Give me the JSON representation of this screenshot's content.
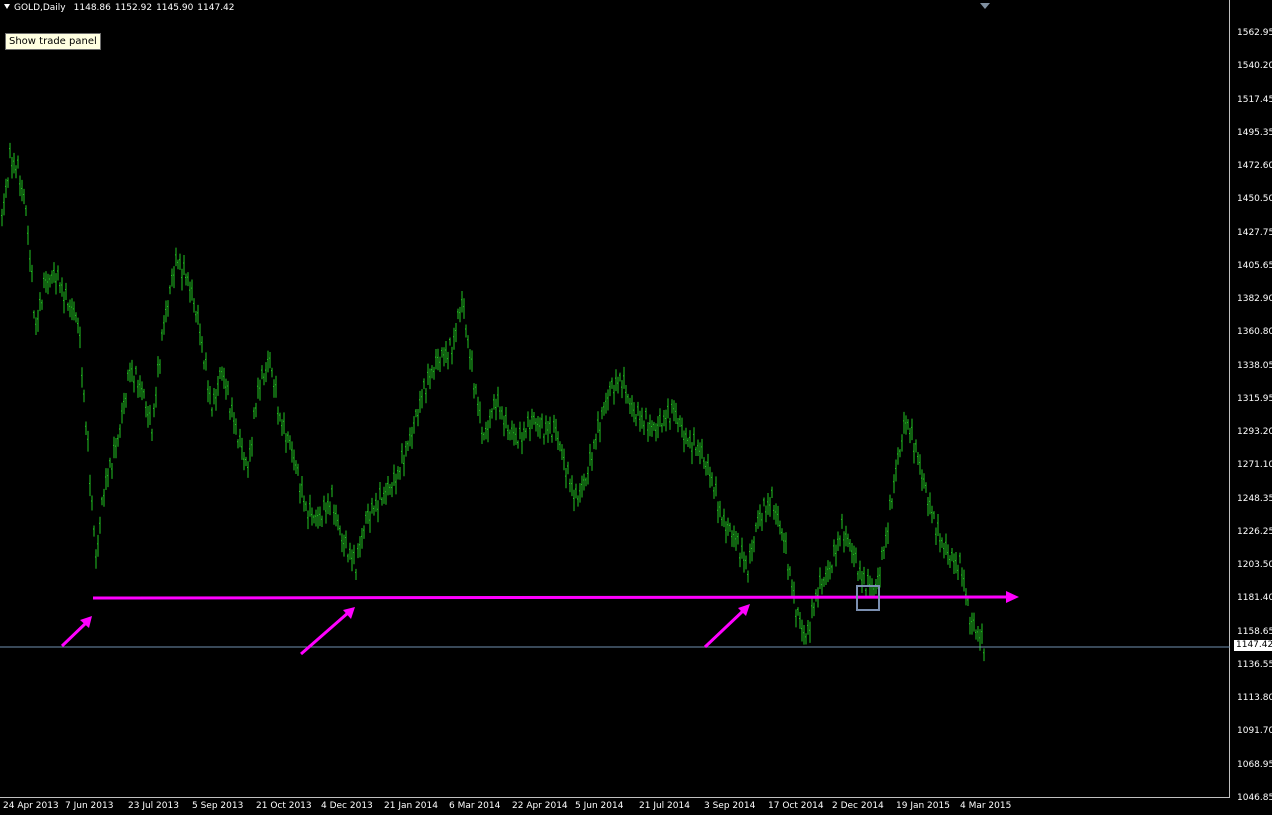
{
  "header": {
    "symbol": "GOLD,Daily",
    "open": "1148.86",
    "high": "1152.92",
    "low": "1145.90",
    "close": "1147.42"
  },
  "trade_panel_label": "Show trade panel",
  "colors": {
    "background": "#000000",
    "candle": "#22c322",
    "support_line": "#ff00ff",
    "arrows": "#ff00ff",
    "marker_box": "#7b8fb0",
    "price_line": "#6f8faf",
    "axis_text": "#ffffff"
  },
  "price_axis": [
    "1562.95",
    "1540.20",
    "1517.45",
    "1495.35",
    "1472.60",
    "1450.50",
    "1427.75",
    "1405.65",
    "1382.90",
    "1360.80",
    "1338.05",
    "1315.95",
    "1293.20",
    "1271.10",
    "1248.35",
    "1226.25",
    "1203.50",
    "1181.40",
    "1158.65",
    "1136.55",
    "1113.80",
    "1091.70",
    "1068.95",
    "1046.85"
  ],
  "current_price": "1147.42",
  "date_axis": [
    "24 Apr 2013",
    "7 Jun 2013",
    "23 Jul 2013",
    "5 Sep 2013",
    "21 Oct 2013",
    "4 Dec 2013",
    "21 Jan 2014",
    "6 Mar 2014",
    "22 Apr 2014",
    "5 Jun 2014",
    "21 Jul 2014",
    "3 Sep 2014",
    "17 Oct 2014",
    "2 Dec 2014",
    "19 Jan 2015",
    "4 Mar 2015"
  ],
  "support_level": 1181.4,
  "icons": [
    "dropdown-triangle-icon",
    "chart-shift-icon",
    "arrow-icon"
  ]
}
